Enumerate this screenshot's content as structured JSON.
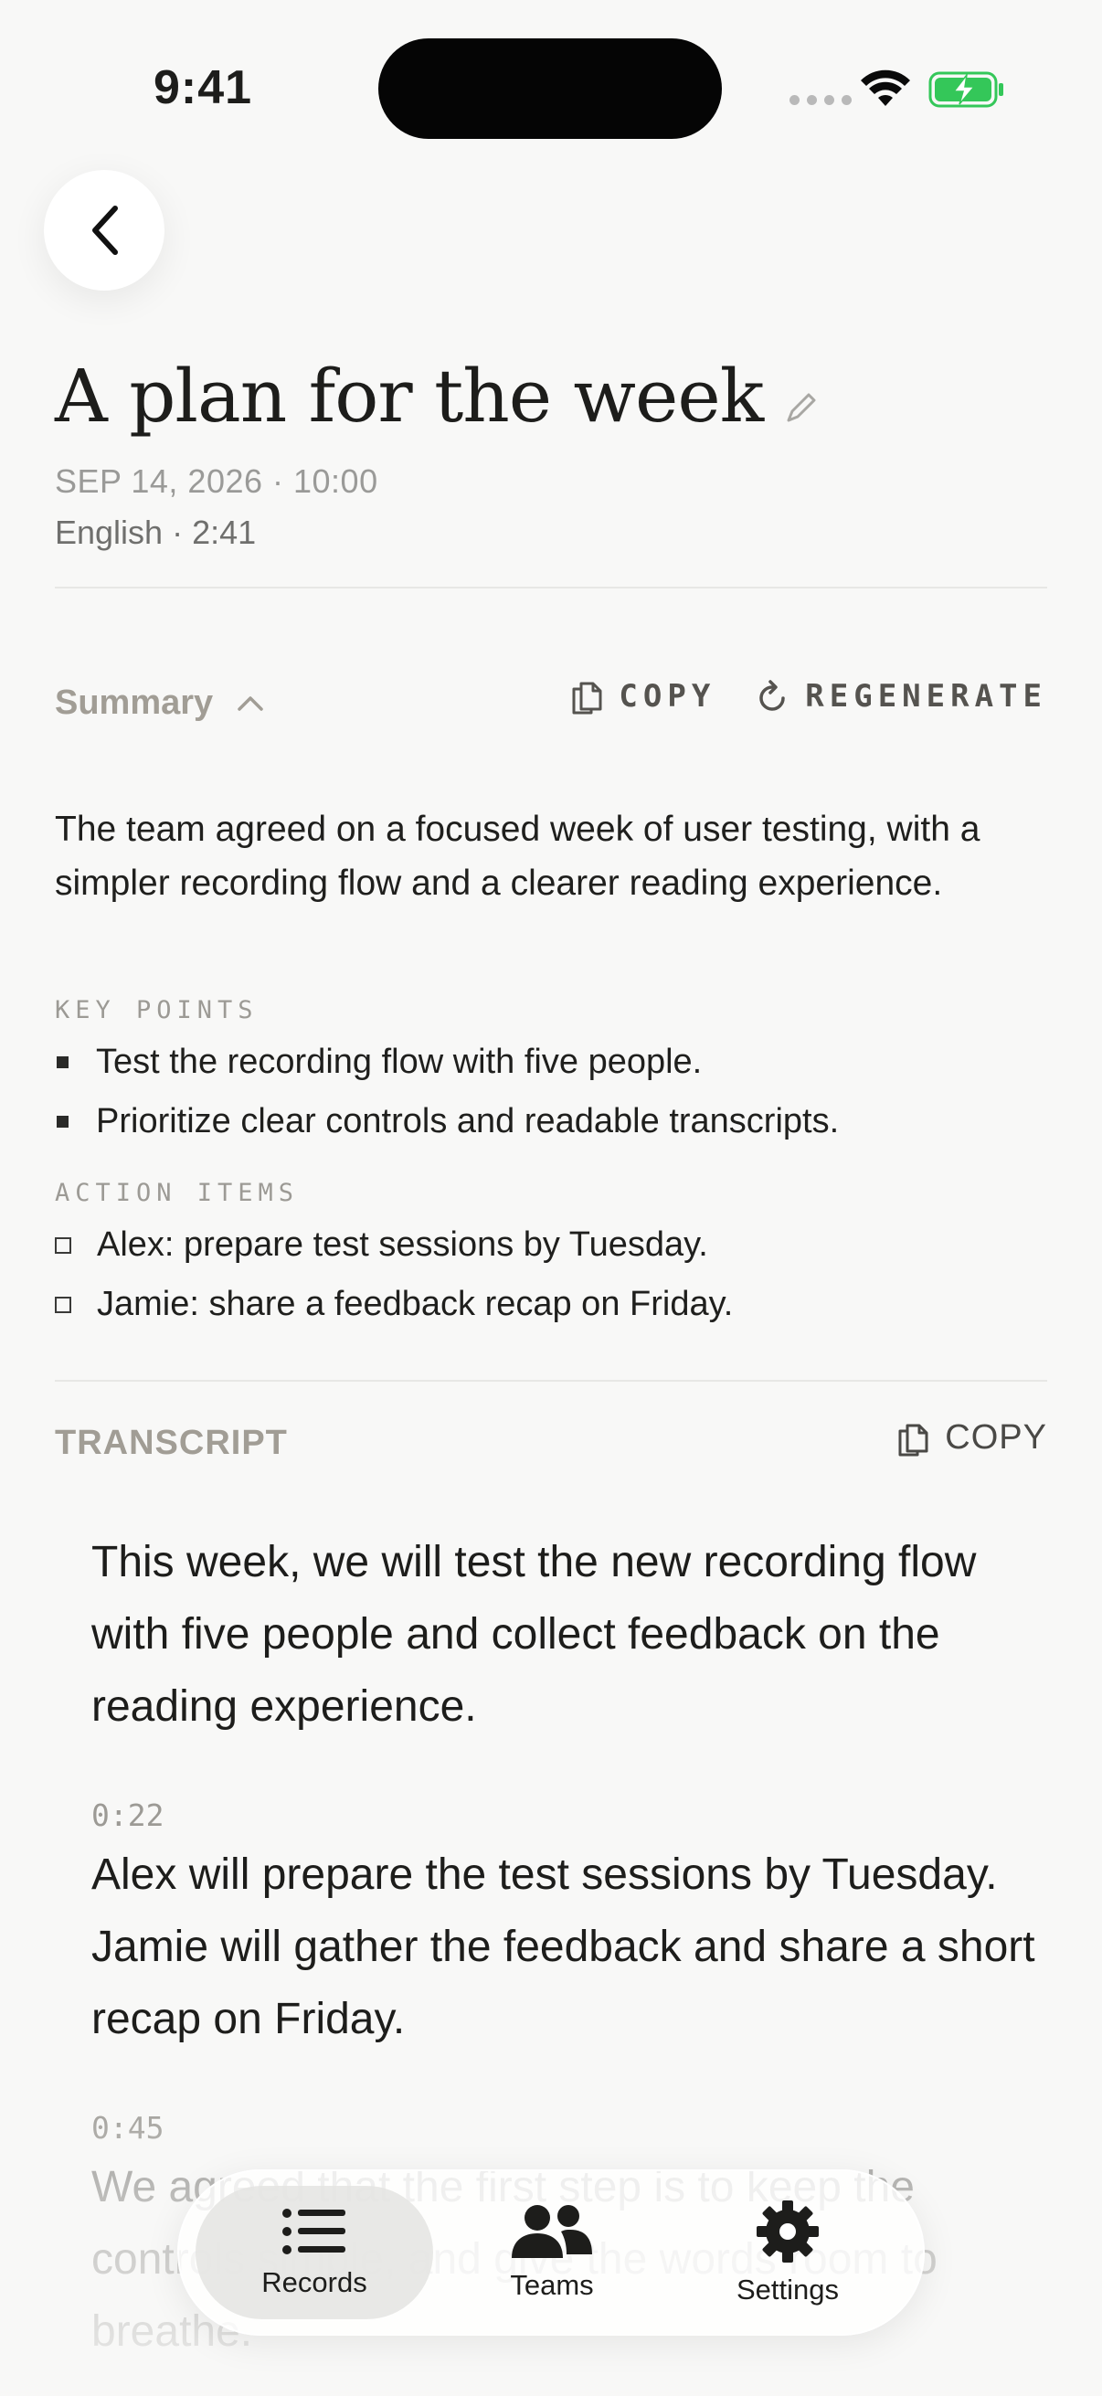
{
  "status_bar": {
    "time": "9:41"
  },
  "header": {
    "title": "A plan for the week",
    "date": "SEP 14, 2026 · 10:00",
    "language_duration": "English · 2:41"
  },
  "summary": {
    "label": "Summary",
    "copy_label": "COPY",
    "regenerate_label": "REGENERATE",
    "body": "The team agreed on a focused week of user testing, with a simpler recording flow and a clearer reading experience.",
    "key_points_label": "KEY POINTS",
    "key_points": [
      "Test the recording flow with five people.",
      "Prioritize clear controls and readable transcripts."
    ],
    "action_items_label": "ACTION ITEMS",
    "action_items": [
      "Alex: prepare test sessions by Tuesday.",
      "Jamie: share a feedback recap on Friday."
    ]
  },
  "transcript": {
    "label": "TRANSCRIPT",
    "copy_label": "COPY",
    "segments": [
      {
        "time": "",
        "text": "This week, we will test the new recording flow with five people and collect feedback on the reading experience."
      },
      {
        "time": "0:22",
        "text": "Alex will prepare the test sessions by Tuesday. Jamie will gather the feedback and share a short recap on Friday."
      },
      {
        "time": "0:45",
        "text": "We agreed that the first step is to keep the controls simple, and give the words room to breathe."
      }
    ]
  },
  "tab_bar": {
    "tabs": [
      {
        "label": "Records",
        "icon": "list-icon",
        "active": true
      },
      {
        "label": "Teams",
        "icon": "people-icon",
        "active": false
      },
      {
        "label": "Settings",
        "icon": "gear-icon",
        "active": false
      }
    ]
  },
  "colors": {
    "background": "#f8f8f7",
    "text": "#1d1d1b",
    "muted": "#a19d95",
    "battery_green": "#34c759"
  }
}
